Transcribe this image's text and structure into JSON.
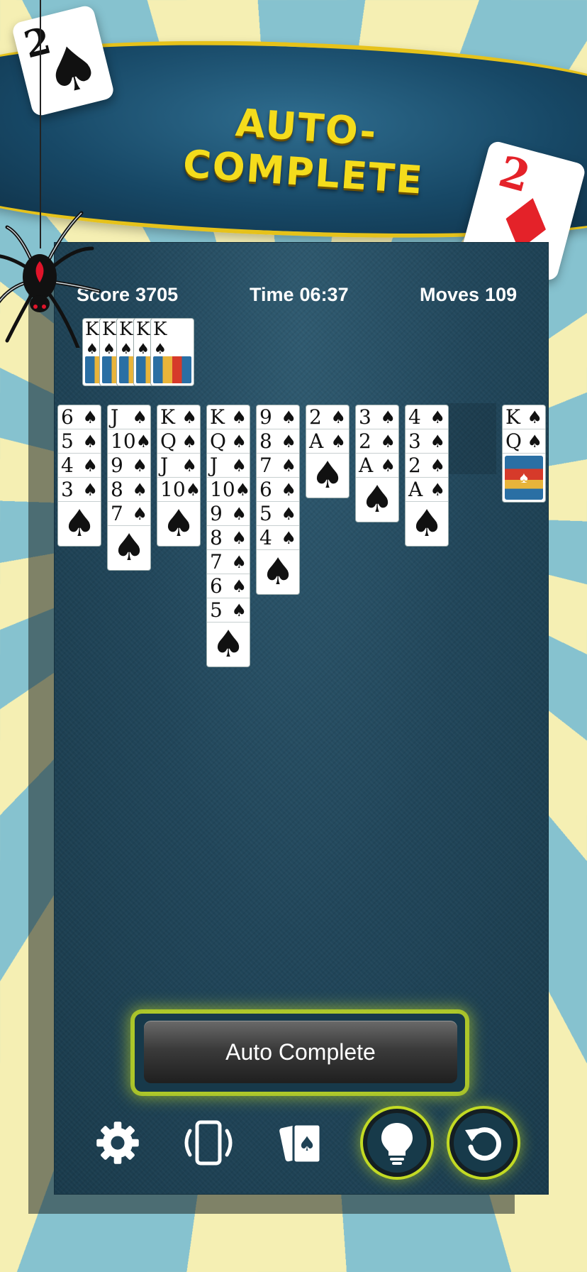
{
  "banner": {
    "title": "AUTO-COMPLETE"
  },
  "promo_cards": [
    {
      "rank": "2",
      "suit": "♠"
    },
    {
      "rank": "2",
      "suit": "♦"
    }
  ],
  "hud": {
    "score_label": "Score",
    "score_value": "3705",
    "time_label": "Time",
    "time_value": "06:37",
    "moves_label": "Moves",
    "moves_value": "109"
  },
  "foundation": {
    "ranks": [
      "K",
      "K",
      "K",
      "K",
      "K"
    ],
    "top_rank": "K",
    "suit": "♠"
  },
  "tableau": [
    {
      "cards": [
        "6",
        "5",
        "4",
        "3"
      ]
    },
    {
      "cards": [
        "J",
        "10",
        "9",
        "8",
        "7"
      ]
    },
    {
      "cards": [
        "K",
        "Q",
        "J",
        "10"
      ]
    },
    {
      "cards": [
        "K",
        "Q",
        "J",
        "10",
        "9",
        "8",
        "7",
        "6",
        "5"
      ]
    },
    {
      "cards": [
        "9",
        "8",
        "7",
        "6",
        "5",
        "4"
      ]
    },
    {
      "cards": [
        "2",
        "A"
      ]
    },
    {
      "cards": [
        "3",
        "2",
        "A"
      ]
    },
    {
      "cards": [
        "4",
        "3",
        "2",
        "A"
      ]
    },
    {
      "cards": []
    },
    {
      "cards": [
        "K",
        "Q"
      ],
      "face_card": true
    }
  ],
  "suit_symbol": "♠",
  "auto_complete": {
    "label": "Auto Complete"
  },
  "toolbar": [
    {
      "icon": "gear-icon"
    },
    {
      "icon": "phone-rotate-icon"
    },
    {
      "icon": "cards-icon"
    },
    {
      "icon": "lightbulb-icon",
      "highlighted": true
    },
    {
      "icon": "undo-icon",
      "highlighted": true
    }
  ]
}
